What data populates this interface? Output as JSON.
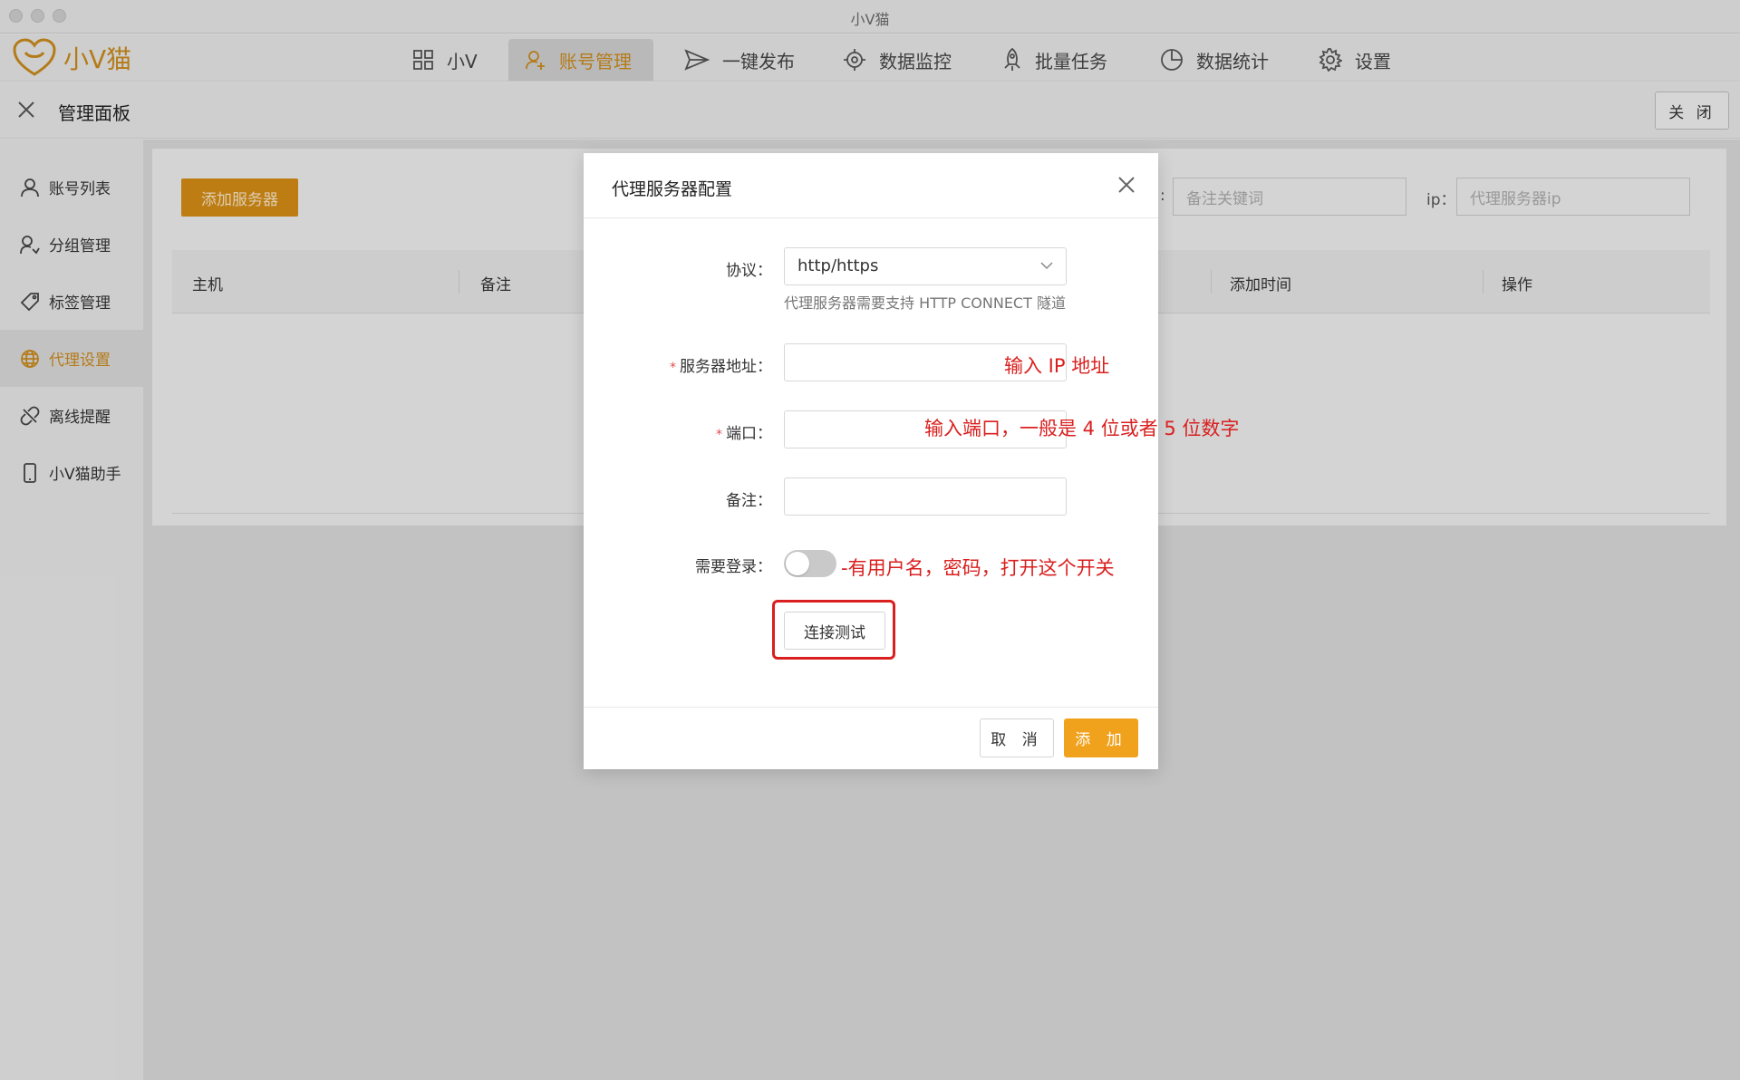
{
  "window": {
    "title": "小V猫"
  },
  "brand": {
    "name": "小V猫",
    "color": "#c98a1d"
  },
  "nav": {
    "items": [
      {
        "label": "小V",
        "icon": "grid-icon",
        "active": false
      },
      {
        "label": "账号管理",
        "icon": "user-add-icon",
        "active": true
      },
      {
        "label": "一键发布",
        "icon": "send-icon",
        "active": false
      },
      {
        "label": "数据监控",
        "icon": "target-icon",
        "active": false
      },
      {
        "label": "批量任务",
        "icon": "rocket-icon",
        "active": false
      },
      {
        "label": "数据统计",
        "icon": "pie-chart-icon",
        "active": false
      },
      {
        "label": "设置",
        "icon": "gear-icon",
        "active": false
      }
    ]
  },
  "panel": {
    "title": "管理面板",
    "close_label": "关 闭"
  },
  "sidebar": {
    "items": [
      {
        "label": "账号列表",
        "icon": "user-icon",
        "active": false
      },
      {
        "label": "分组管理",
        "icon": "group-icon",
        "active": false
      },
      {
        "label": "标签管理",
        "icon": "tag-icon",
        "active": false
      },
      {
        "label": "代理设置",
        "icon": "globe-icon",
        "active": true
      },
      {
        "label": "离线提醒",
        "icon": "broken-link-icon",
        "active": false
      },
      {
        "label": "小V猫助手",
        "icon": "phone-icon",
        "active": false
      }
    ]
  },
  "content": {
    "add_server_label": "添加服务器",
    "remark_filter_placeholder": "备注关键词",
    "ip_label": "ip：",
    "ip_filter_placeholder": "代理服务器ip",
    "columns": [
      "主机",
      "备注",
      "添加时间",
      "操作"
    ]
  },
  "dialog": {
    "title": "代理服务器配置",
    "protocol_label": "协议：",
    "protocol_value": "http/https",
    "protocol_hint": "代理服务器需要支持 HTTP CONNECT 隧道",
    "server_label": "服务器地址：",
    "port_label": "端口：",
    "remark_label": "备注：",
    "login_label": "需要登录：",
    "login_enabled": false,
    "test_label": "连接测试",
    "cancel_label": "取 消",
    "add_label": "添 加"
  },
  "annotations": {
    "server": "输入 IP 地址",
    "port": "输入端口，一般是 4 位或者 5 位数字",
    "login": "-有用户名，密码，打开这个开关"
  },
  "colors": {
    "accent": "#f0a21d",
    "annotation": "#d9201f"
  }
}
